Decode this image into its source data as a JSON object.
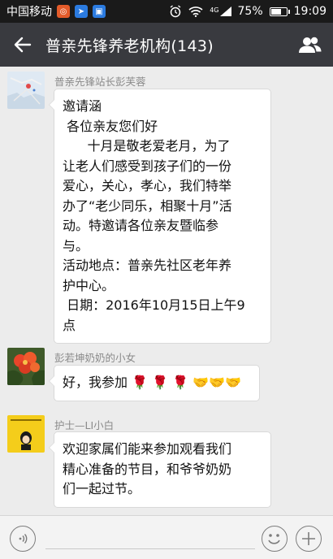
{
  "status_bar": {
    "carrier": "中国移动",
    "network": "4G",
    "battery_percent": "75%",
    "battery_level": 0.75,
    "time": "19:09"
  },
  "title_bar": {
    "title": "普亲先锋养老机构(143)",
    "back_icon": "arrow-left-icon",
    "group_icon": "group-members-icon"
  },
  "messages": [
    {
      "sender": "普亲先锋站长彭芙蓉",
      "lines": [
        "邀请涵",
        " 各位亲友您们好",
        "      十月是敬老爱老月，为了",
        "让老人们感受到孩子们的一份",
        "爱心，关心，孝心，我们特举",
        "办了“老少同乐，相聚十月”活",
        "动。特邀请各位亲友暨临参",
        "与。",
        "活动地点：普亲先社区老年养",
        "护中心。",
        " 日期：2016年10月15日上午9",
        "点"
      ]
    },
    {
      "sender": "彭若坤奶奶的小女",
      "lines": [
        "好，我参加 🌹 🌹 🌹 🤝🤝🤝"
      ]
    },
    {
      "sender": "护士—LI小白",
      "lines": [
        "欢迎家属们能来参加观看我们",
        "精心准备的节目，和爷爷奶奶",
        "们一起过节。"
      ]
    }
  ],
  "input_bar": {
    "voice_icon": "voice-icon",
    "emoji_icon": "emoji-icon",
    "plus_icon": "plus-icon"
  },
  "colors": {
    "title_bar": "#393a3f",
    "chat_background": "#ececec",
    "bubble": "#ffffff"
  }
}
